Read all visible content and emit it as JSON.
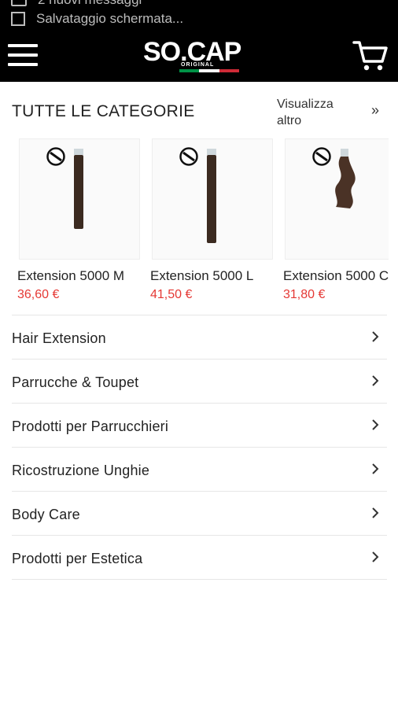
{
  "status_bar": {
    "notification_1": "2 nuovi messaggi",
    "notification_2": "Salvataggio schermata..."
  },
  "header": {
    "logo_text": "SO.CAP",
    "logo_sub": "ORIGINAL",
    "menu_icon": "hamburger-icon",
    "cart_icon": "cart-icon",
    "flag_colors": [
      "#009246",
      "#ffffff",
      "#ce2b37"
    ]
  },
  "section": {
    "title": "TUTTE LE CATEGORIE",
    "see_more": "Visualizza altro",
    "see_more_arrow": "»"
  },
  "products": [
    {
      "name": "Extension 5000 M",
      "price": "36,60 €",
      "image": "straight-hair-strand"
    },
    {
      "name": "Extension 5000 L",
      "price": "41,50 €",
      "image": "straight-hair-strand"
    },
    {
      "name": "Extension 5000 C",
      "price": "31,80 €",
      "image": "wavy-hair-strand"
    }
  ],
  "categories": [
    {
      "label": "Hair Extension"
    },
    {
      "label": "Parrucche & Toupet"
    },
    {
      "label": "Prodotti per Parrucchieri"
    },
    {
      "label": "Ricostruzione Unghie"
    },
    {
      "label": "Body Care"
    },
    {
      "label": "Prodotti per Estetica"
    }
  ],
  "colors": {
    "header_bg": "#000000",
    "price": "#e53935",
    "divider": "#e6e6e6"
  }
}
